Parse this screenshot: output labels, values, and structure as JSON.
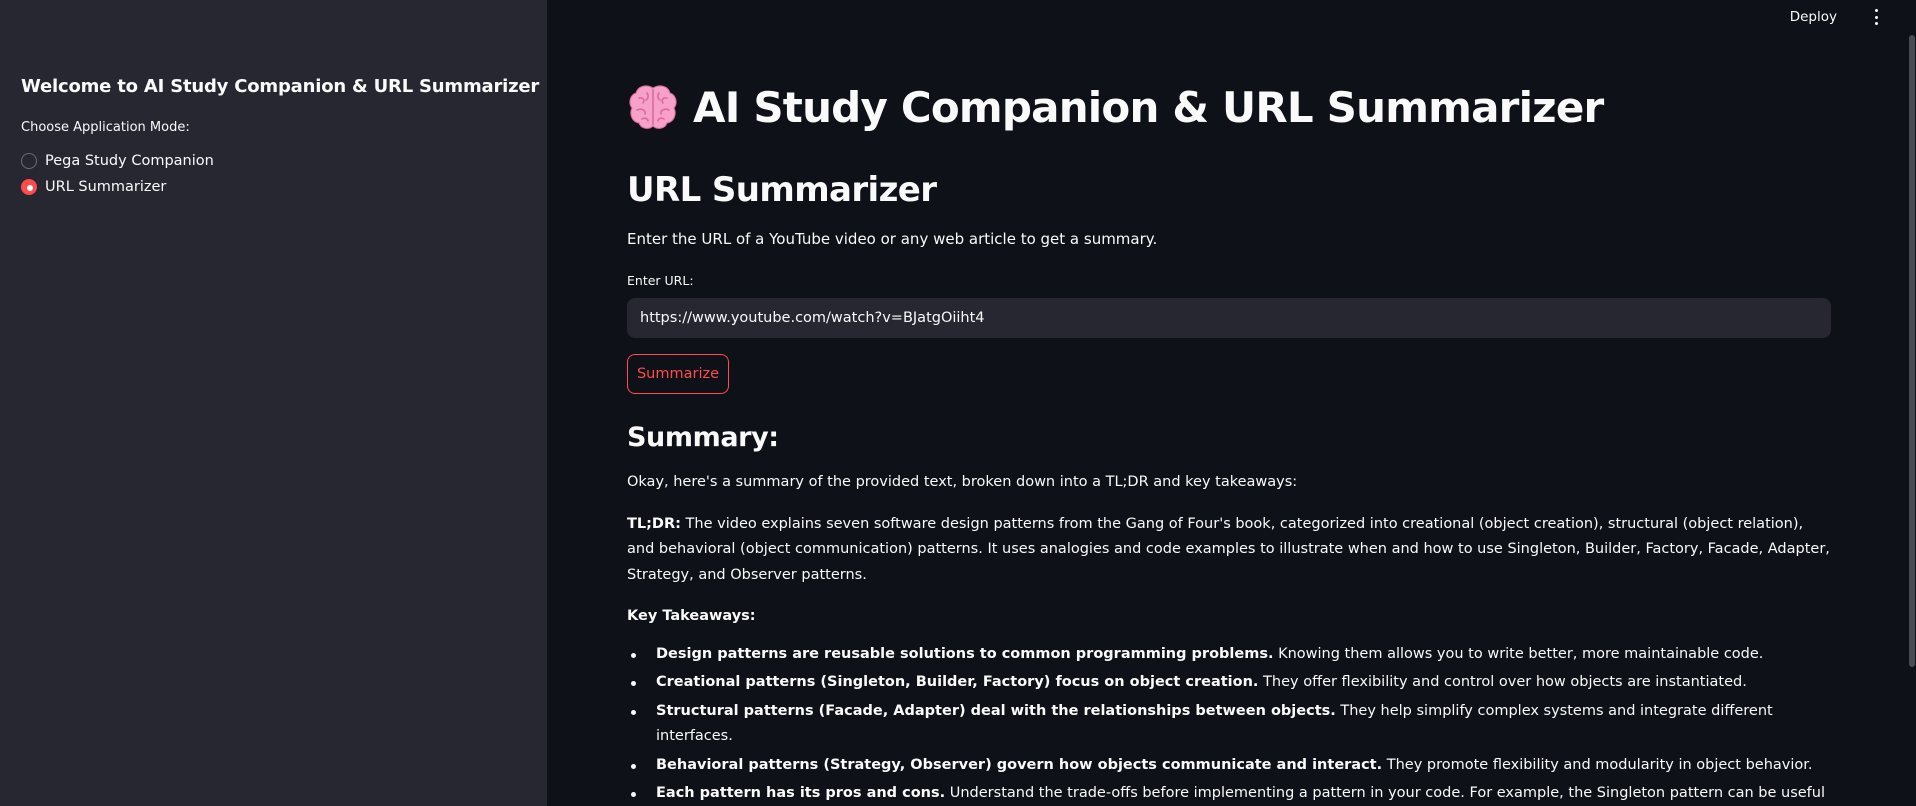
{
  "sidebar": {
    "title": "Welcome to AI Study Companion & URL Summarizer",
    "mode_label": "Choose Application Mode:",
    "options": [
      {
        "label": "Pega Study Companion",
        "selected": false
      },
      {
        "label": "URL Summarizer",
        "selected": true
      }
    ]
  },
  "topbar": {
    "deploy_label": "Deploy",
    "menu_icon": "kebab-menu-icon"
  },
  "main": {
    "icon": "brain-emoji-icon",
    "title": "AI Study Companion & URL Summarizer",
    "section_title": "URL Summarizer",
    "intro": "Enter the URL of a YouTube video or any web article to get a summary.",
    "url_label": "Enter URL:",
    "url_value": "https://www.youtube.com/watch?v=BJatgOiiht4",
    "button_label": "Summarize",
    "summary_heading": "Summary:",
    "summary_intro": "Okay, here's a summary of the provided text, broken down into a TL;DR and key takeaways:",
    "tldr_label": "TL;DR:",
    "tldr_text": " The video explains seven software design patterns from the Gang of Four's book, categorized into creational (object creation), structural (object relation), and behavioral (object communication) patterns. It uses analogies and code examples to illustrate when and how to use Singleton, Builder, Factory, Facade, Adapter, Strategy, and Observer patterns.",
    "takeaways_label": "Key Takeaways:",
    "takeaways": [
      {
        "bold": "Design patterns are reusable solutions to common programming problems.",
        "text": " Knowing them allows you to write better, more maintainable code."
      },
      {
        "bold": "Creational patterns (Singleton, Builder, Factory) focus on object creation.",
        "text": " They offer flexibility and control over how objects are instantiated."
      },
      {
        "bold": "Structural patterns (Facade, Adapter) deal with the relationships between objects.",
        "text": " They help simplify complex systems and integrate different interfaces."
      },
      {
        "bold": "Behavioral patterns (Strategy, Observer) govern how objects communicate and interact.",
        "text": " They promote flexibility and modularity in object behavior."
      },
      {
        "bold": "Each pattern has its pros and cons.",
        "text": " Understand the trade-offs before implementing a pattern in your code. For example, the Singleton pattern can be useful but also hard to test, while the Strategy pattern often involves creating multiple classes."
      }
    ]
  },
  "colors": {
    "main_bg": "#0e1117",
    "sidebar_bg": "#262730",
    "accent": "#ff4b4b",
    "text": "#fafafa"
  }
}
